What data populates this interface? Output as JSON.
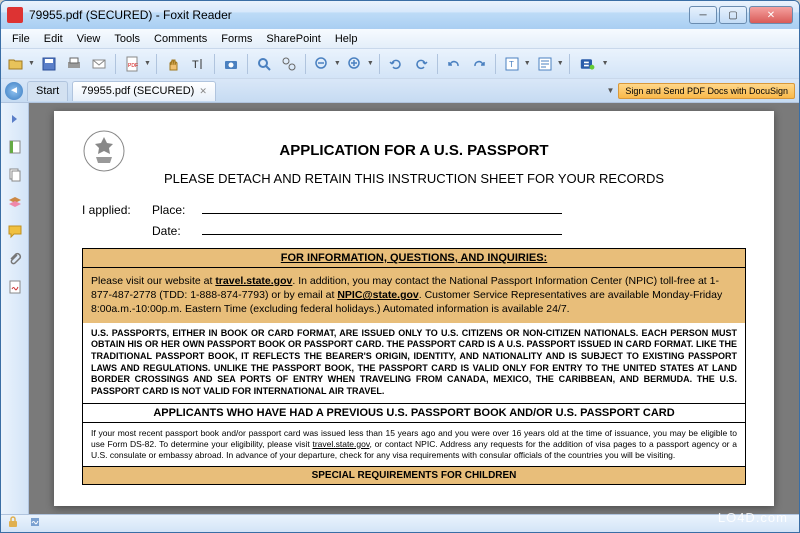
{
  "window": {
    "title": "79955.pdf (SECURED) - Foxit Reader"
  },
  "menu": {
    "items": [
      "File",
      "Edit",
      "View",
      "Tools",
      "Comments",
      "Forms",
      "SharePoint",
      "Help"
    ]
  },
  "tabs": {
    "start": "Start",
    "file": "79955.pdf (SECURED)"
  },
  "docusign": {
    "label": "Sign and Send PDF Docs with DocuSign"
  },
  "document": {
    "title": "APPLICATION FOR A U.S. PASSPORT",
    "subtitle": "PLEASE DETACH AND RETAIN THIS INSTRUCTION SHEET FOR YOUR RECORDS",
    "applied_label": "I applied:",
    "place_label": "Place:",
    "date_label": "Date:",
    "info_header": "FOR INFORMATION, QUESTIONS, AND INQUIRIES:",
    "info_body_1": "Please visit our website at ",
    "info_link_1": "travel.state.gov",
    "info_body_2": ".  In addition, you may contact the National Passport Information Center (NPIC) toll-free at 1-877-487-2778 (TDD: 1-888-874-7793) or by email at ",
    "info_link_2": "NPIC@state.gov",
    "info_body_3": ".  Customer Service Representatives are available Monday-Friday 8:00a.m.-10:00p.m. Eastern Time (excluding federal holidays.)  Automated information is available 24/7.",
    "passports_body": "U.S. PASSPORTS, EITHER IN BOOK OR CARD FORMAT, ARE ISSUED ONLY TO U.S. CITIZENS OR NON-CITIZEN NATIONALS.  EACH PERSON MUST OBTAIN HIS OR HER OWN PASSPORT BOOK OR PASSPORT CARD.  THE PASSPORT CARD IS A U.S. PASSPORT ISSUED IN CARD FORMAT.  LIKE THE TRADITIONAL PASSPORT BOOK, IT REFLECTS THE BEARER'S ORIGIN, IDENTITY, AND NATIONALITY AND IS SUBJECT TO EXISTING PASSPORT LAWS AND REGULATIONS.  UNLIKE THE PASSPORT BOOK, THE PASSPORT CARD IS VALID ONLY FOR ENTRY TO THE UNITED STATES AT LAND BORDER CROSSINGS AND SEA PORTS OF ENTRY WHEN TRAVELING FROM CANADA, MEXICO, THE CARIBBEAN, AND BERMUDA.  THE U.S. PASSPORT CARD IS NOT VALID FOR INTERNATIONAL AIR TRAVEL.",
    "previous_header": "APPLICANTS WHO HAVE HAD A PREVIOUS U.S. PASSPORT BOOK AND/OR U.S. PASSPORT CARD",
    "previous_body_1": "If your most recent passport book and/or passport card was issued less than 15 years ago and you were over 16 years old at the time of issuance, you may be eligible to use Form DS-82.  To determine your eligibility, please visit ",
    "previous_link": "travel.state.gov",
    "previous_body_2": ", or contact NPIC.   Address any requests for the addition of visa pages to a passport agency or a U.S. consulate or embassy abroad.  In advance of your departure, check for any visa requirements with consular officials of the countries you will be visiting.",
    "special_header": "SPECIAL REQUIREMENTS FOR CHILDREN"
  },
  "watermark": "LO4D.com"
}
